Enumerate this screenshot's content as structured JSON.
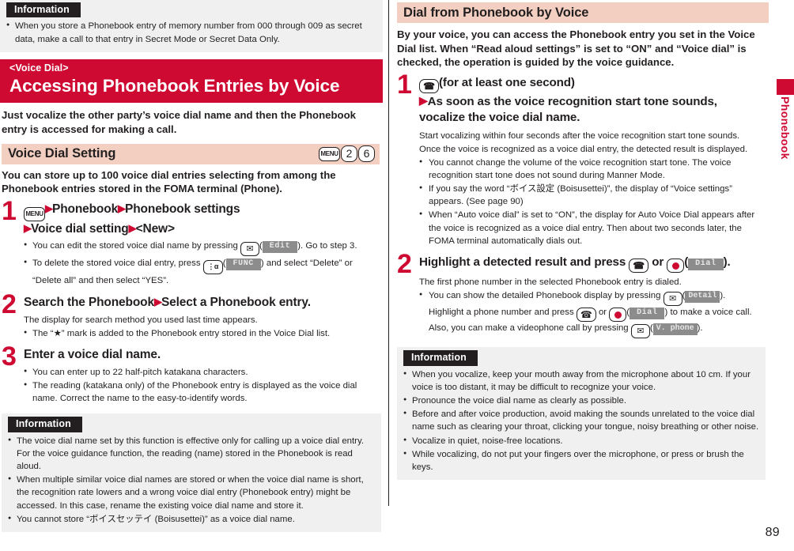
{
  "page_number": "89",
  "thumb_tab": {
    "label": "Phonebook"
  },
  "left": {
    "top_information": {
      "heading": "Information",
      "items": [
        "When you store a Phonebook entry of memory number from 000 through 009 as secret data, make a call to that entry in Secret Mode or Secret Data Only."
      ]
    },
    "banner": {
      "kicker": "<Voice Dial>",
      "title": "Accessing Phonebook Entries by Voice"
    },
    "lead": "Just vocalize the other party’s voice dial name and then the Phonebook entry is accessed for making a call.",
    "subhead": {
      "title": "Voice Dial Setting",
      "keys": [
        "MENU",
        "2",
        "6"
      ]
    },
    "intro": "You can store up to 100 voice dial entries selecting from among the Phonebook entries stored in the FOMA terminal (Phone).",
    "steps": [
      {
        "num": "1",
        "head_key": "MENU",
        "head_part1": "Phonebook",
        "head_part2": "Phonebook settings",
        "head_part3": "Voice dial setting",
        "head_part4": "<New>",
        "bullets": [
          {
            "pre": "You can edit the stored voice dial name by pressing ",
            "key": "mail-key",
            "softkey": "Edit",
            "post": "). Go to step 3."
          },
          {
            "pre": "To delete the stored voice dial entry, press ",
            "key": "func-key",
            "softkey": "FUNC",
            "post": ") and select “Delete” or “Delete all” and then select “YES”."
          }
        ]
      },
      {
        "num": "2",
        "head_part1": "Search the Phonebook",
        "head_part2": "Select a Phonebook entry.",
        "note": "The display for search method you used last time appears.",
        "bullets": [
          {
            "text": "The “★” mark is added to the Phonebook entry stored in the Voice Dial list."
          }
        ]
      },
      {
        "num": "3",
        "head_part1": "Enter a voice dial name.",
        "bullets": [
          {
            "text": "You can enter up to 22 half-pitch katakana characters."
          },
          {
            "text": "The reading (katakana only) of the Phonebook entry is displayed as the voice dial name. Correct the name to the easy-to-identify words."
          }
        ]
      }
    ],
    "bottom_information": {
      "heading": "Information",
      "items": [
        "The voice dial name set by this function is effective only for calling up a voice dial entry. For the voice guidance function, the reading (name) stored in the Phonebook is read aloud.",
        "When multiple similar voice dial names are stored or when the voice dial name is short, the recognition rate lowers and a wrong voice dial entry (Phonebook entry) might be accessed. In this case, rename the existing voice dial name and store it.",
        "You cannot store “ボイスセッテイ (Boisusettei)” as a voice dial name."
      ]
    }
  },
  "right": {
    "subhead": {
      "title": "Dial from Phonebook by Voice"
    },
    "intro": "By your voice, you can access the Phonebook entry you set in the Voice Dial list. When “Read aloud settings” is set to “ON” and “Voice dial” is checked, the operation is guided by the voice guidance.",
    "steps": [
      {
        "num": "1",
        "head_suffix": "(for at least one second)",
        "head_line2": "As soon as the voice recognition start tone sounds,",
        "head_line3": "vocalize the voice dial name.",
        "note_line1": "Start vocalizing within four seconds after the voice recognition start tone sounds.",
        "note_line2": "Once the voice is recognized as a voice dial entry, the detected result is displayed.",
        "bullets": [
          {
            "text": "You cannot change the volume of the voice recognition start tone. The voice recognition start tone does not sound during Manner Mode."
          },
          {
            "text": "If you say the word “ボイス設定 (Boisusettei)”, the display of “Voice settings” appears. (See page 90)"
          },
          {
            "text": "When “Auto voice dial” is set to “ON”, the display for Auto Voice Dial appears after the voice is recognized as a voice dial entry. Then about two seconds later, the FOMA terminal automatically dials out."
          }
        ]
      },
      {
        "num": "2",
        "head_pre": "Highlight a detected result and press ",
        "head_or": " or ",
        "softkey": "Dial",
        "head_post": ").",
        "note": "The first phone number in the selected Phonebook entry is dialed.",
        "bullet_line1_pre": "You can show the detailed Phonebook display by pressing ",
        "bullet_softkey1": "Detail",
        "bullet_line1_post": ").",
        "bullet_line2_pre": "Highlight a phone number and press ",
        "bullet_line2_or": " or ",
        "bullet_softkey2": "Dial",
        "bullet_line2_post": ") to make a voice call.",
        "bullet_line3_pre": "Also, you can make a videophone call by pressing ",
        "bullet_softkey3": "V. phone",
        "bullet_line3_post": ")."
      }
    ],
    "information": {
      "heading": "Information",
      "items": [
        "When you vocalize, keep your mouth away from the microphone about 10 cm. If your voice is too distant, it may be difficult to recognize your voice.",
        "Pronounce the voice dial name as clearly as possible.",
        "Before and after voice production, avoid making the sounds unrelated to the voice dial name such as clearing your throat, clicking your tongue, noisy breathing or other noise.",
        "Vocalize in quiet, noise-free locations.",
        "While vocalizing, do not put your fingers over the microphone, or press or brush the keys."
      ]
    }
  },
  "colors": {
    "brand_red": "#cf0a32",
    "subhead_pink": "#f2cfc0",
    "info_bg": "#f0f0f0",
    "info_tab_bg": "#231f20",
    "softkey_bg": "#8c8c8c"
  }
}
